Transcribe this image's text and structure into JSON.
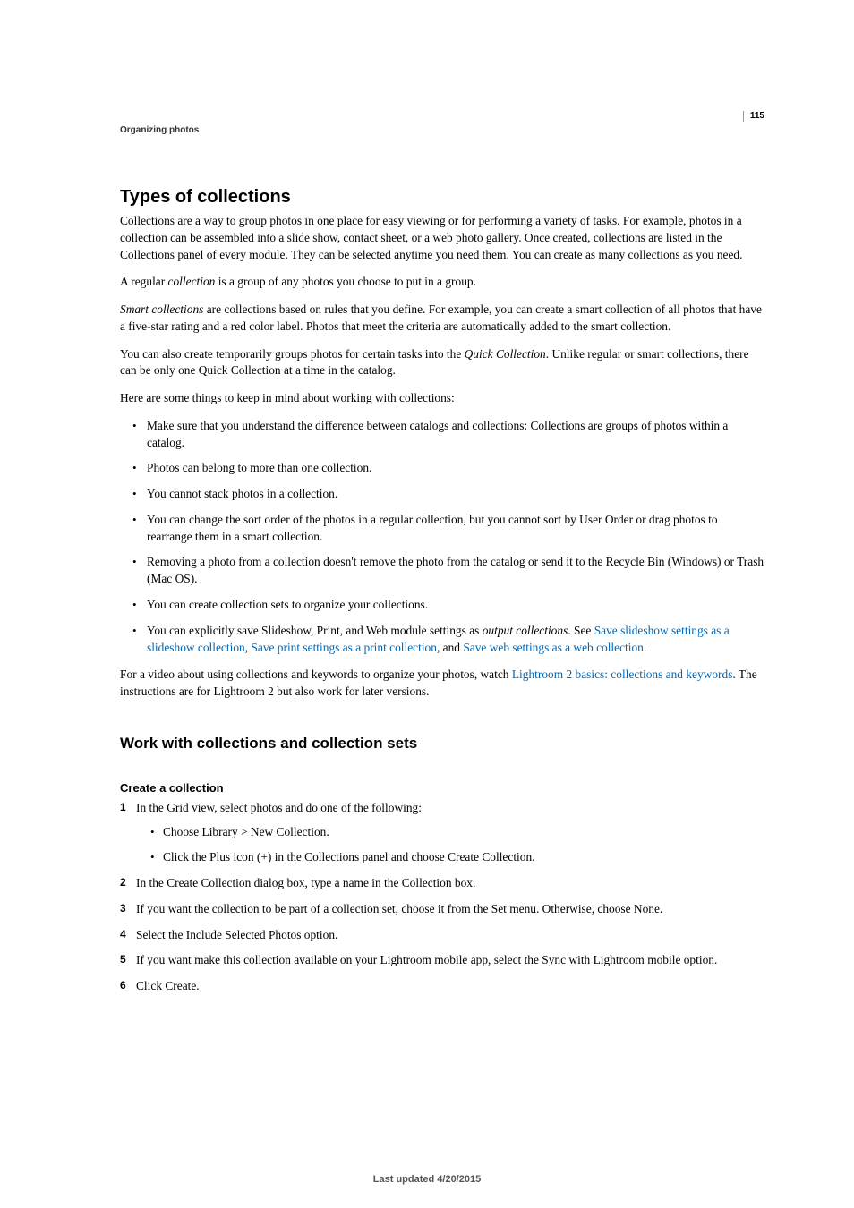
{
  "header": {
    "section": "Organizing photos",
    "page_number": "115"
  },
  "h1": "Types of collections",
  "p1_1": "Collections are a way to group photos in one place for easy viewing or for performing a variety of tasks. For example, photos in a collection can be assembled into a slide show, contact sheet, or a web photo gallery. Once created, collections are listed in the Collections panel of every module. They can be selected anytime you need them. You can create as many collections as you need.",
  "p2_pre": "A regular ",
  "p2_em": "collection",
  "p2_post": " is a group of any photos you choose to put in a group.",
  "p3_em": "Smart collections",
  "p3_post": " are collections based on rules that you define. For example, you can create a smart collection of all photos that have a five-star rating and a red color label. Photos that meet the criteria are automatically added to the smart collection.",
  "p4_pre": "You can also create temporarily groups photos for certain tasks into the ",
  "p4_em": "Quick Collection",
  "p4_post": ". Unlike regular or smart collections, there can be only one Quick Collection at a time in the catalog.",
  "p5": "Here are some things to keep in mind about working with collections:",
  "bullets": {
    "b1": "Make sure that you understand the difference between catalogs and collections: Collections are groups of photos within a catalog.",
    "b2": "Photos can belong to more than one collection.",
    "b3": "You cannot stack photos in a collection.",
    "b4": "You can change the sort order of the photos in a regular collection, but you cannot sort by User Order or drag photos to rearrange them in a smart collection.",
    "b5": "Removing a photo from a collection doesn't remove the photo from the catalog or send it to the Recycle Bin (Windows) or Trash (Mac OS).",
    "b6": "You can create collection sets to organize your collections.",
    "b7_pre": "You can explicitly save Slideshow, Print, and Web module settings as ",
    "b7_em": "output collections",
    "b7_mid1": ". See ",
    "b7_link1": "Save slideshow settings as a slideshow collection",
    "b7_mid2": ", ",
    "b7_link2": "Save print settings as a print collection",
    "b7_mid3": ", and ",
    "b7_link3": "Save web settings as a web collection",
    "b7_post": "."
  },
  "p6_pre": "For a video about using collections and keywords to organize your photos, watch ",
  "p6_link": "Lightroom 2 basics: collections and keywords",
  "p6_post": ". The instructions are for Lightroom 2 but also work for later versions.",
  "h2": "Work with collections and collection sets",
  "h3": "Create a collection",
  "steps": {
    "s1": "In the Grid view, select photos and do one of the following:",
    "s1a": "Choose Library > New Collection.",
    "s1b": "Click the Plus icon (+) in the Collections panel and choose Create Collection.",
    "s2": "In the Create Collection dialog box, type a name in the Collection box.",
    "s3": "If you want the collection to be part of a collection set, choose it from the Set menu. Otherwise, choose None.",
    "s4": "Select the Include Selected Photos option.",
    "s5": "If you want make this collection available on your Lightroom mobile app, select the Sync with Lightroom mobile option.",
    "s6": "Click Create."
  },
  "footer": "Last updated 4/20/2015"
}
